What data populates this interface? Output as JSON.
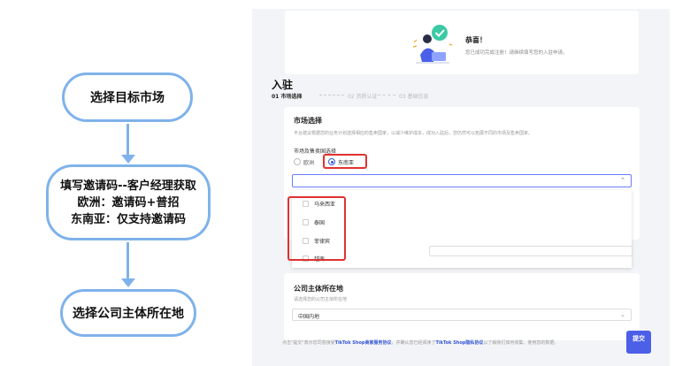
{
  "flowchart": {
    "step1": "选择目标市场",
    "step2": {
      "line1": "填写邀请码--客户经理获取",
      "line2": "欧洲：邀请码+普招",
      "line3": "东南亚：仅支持邀请码"
    },
    "step3": "选择公司主体所在地",
    "border_color": "#7fb2ea"
  },
  "screenshot": {
    "congrats": {
      "title": "恭喜！",
      "subtitle": "您已成功完成注册！请继续填写您的入驻申请。"
    },
    "page_title": "入驻",
    "steps": [
      "01 市场选择",
      "02 资质认证",
      "03 基础信息"
    ],
    "market": {
      "title": "市场选择",
      "description": "平台建议根据您的业务计划选择相应的售卖国家，以减少维护成本，成功入驻后，您仍然可以拓展不同的市场及售卖国家。",
      "region_label": "市场及售卖国选择",
      "options": [
        "欧洲",
        "东南亚"
      ],
      "selected": "东南亚",
      "countries": [
        "马来西亚",
        "泰国",
        "菲律宾",
        "越南"
      ]
    },
    "company": {
      "title": "公司主体所在地",
      "description": "请选择您的公司主体所在地",
      "value": "中国内地"
    },
    "footer": {
      "prefix": "点击\"提交\"表示您同意接受",
      "link1": "TikTok Shop商家服务协议",
      "middle": "，并确认您已经阅读了",
      "link2": "TikTok Shop隐私协议",
      "suffix": "以了解我们如何收集、使用您的数据。"
    },
    "submit_label": "提交",
    "accent_color": "#3457d5",
    "highlight_color": "#e0312f"
  }
}
